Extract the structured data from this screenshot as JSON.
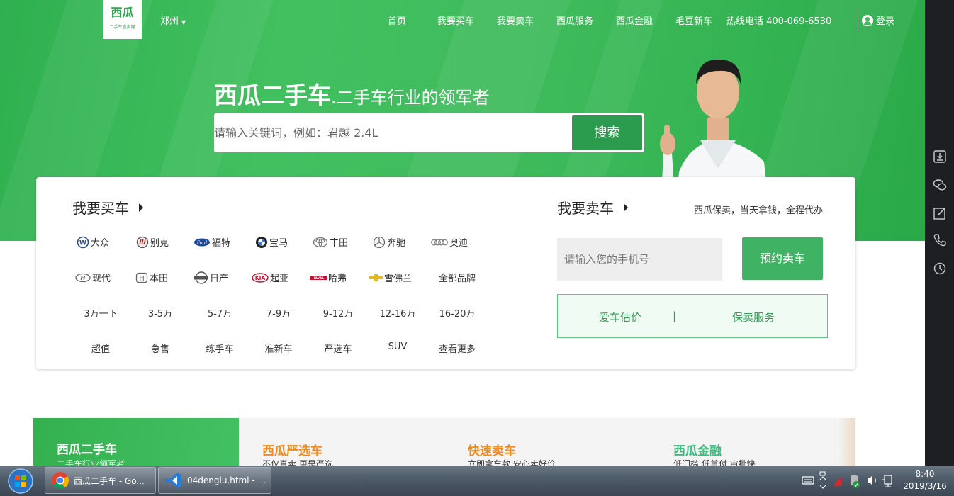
{
  "header": {
    "logo_title": "西瓜",
    "logo_sub": "二手车直卖网",
    "city": "郑州",
    "nav": [
      "首页",
      "我要买车",
      "我要卖车",
      "西瓜服务",
      "西瓜金融",
      "毛豆新车",
      "热线电话 400-069-6530"
    ],
    "login": "登录"
  },
  "hero": {
    "slogan_main": "西瓜二手车",
    "slogan_rest": ".二手车行业的领军者",
    "search_placeholder": "请输入关键词，例如：君越 2.4L",
    "search_button": "搜索"
  },
  "buy": {
    "title": "我要买车",
    "brands": [
      [
        "大众",
        "别克",
        "福特",
        "宝马",
        "丰田",
        "奔驰",
        "奥迪"
      ],
      [
        "现代",
        "本田",
        "日产",
        "起亚",
        "哈弗",
        "雪佛兰",
        "全部品牌"
      ]
    ],
    "prices": [
      "3万一下",
      "3-5万",
      "5-7万",
      "7-9万",
      "9-12万",
      "12-16万",
      "16-20万"
    ],
    "tags": [
      "超值",
      "急售",
      "练手车",
      "准新车",
      "严选车",
      "SUV",
      "查看更多"
    ]
  },
  "sell": {
    "title": "我要卖车",
    "note": "西瓜保卖，当天拿钱，全程代办",
    "phone_placeholder": "请输入您的手机号",
    "book_button": "预约卖车",
    "service_left": "爱车估价",
    "service_sep": "|",
    "service_right": "保卖服务"
  },
  "features": {
    "brand_title": "西瓜二手车",
    "brand_sub": "二手车行业领军者",
    "items": [
      {
        "title": "西瓜严选车",
        "sub": "不仅真卖 更是严选",
        "color": "#f08a1d"
      },
      {
        "title": "快速卖车",
        "sub": "立即拿车款 安心卖好价",
        "color": "#f08a1d"
      },
      {
        "title": "西瓜金融",
        "sub": "低门槛 低首付 审批快",
        "color": "#3dbb7e"
      }
    ]
  },
  "taskbar": {
    "items": [
      "西瓜二手车 - Go...",
      "04denglu.html - ..."
    ],
    "time": "8:40",
    "date": "2019/3/16"
  }
}
